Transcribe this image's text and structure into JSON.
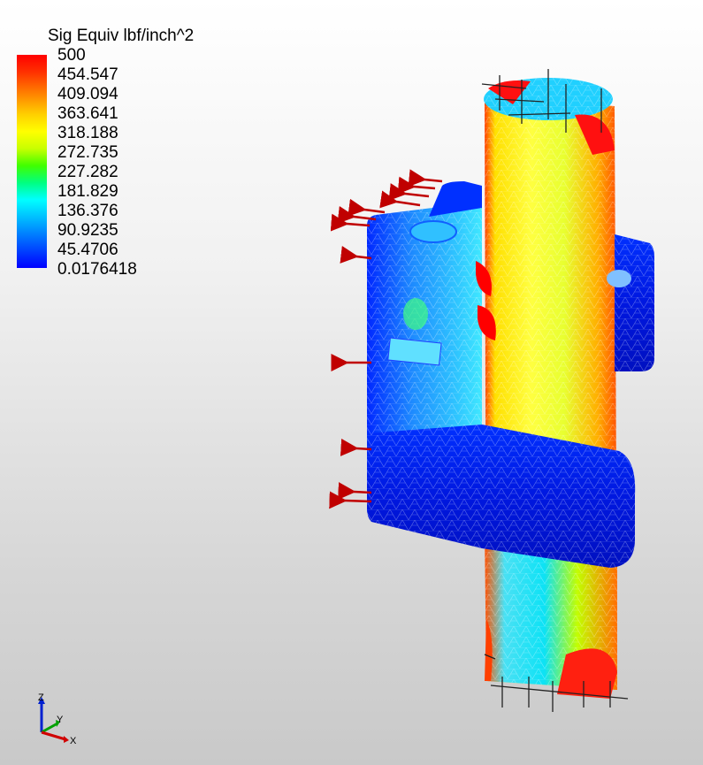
{
  "legend": {
    "title": "Sig Equiv lbf/inch^2",
    "labels": [
      "500",
      "454.547",
      "409.094",
      "363.641",
      "318.188",
      "272.735",
      "227.282",
      "181.829",
      "136.376",
      "90.9235",
      "45.4706",
      "0.0176418"
    ]
  },
  "triad": {
    "z": "Z",
    "y": "Y",
    "x": "X"
  }
}
